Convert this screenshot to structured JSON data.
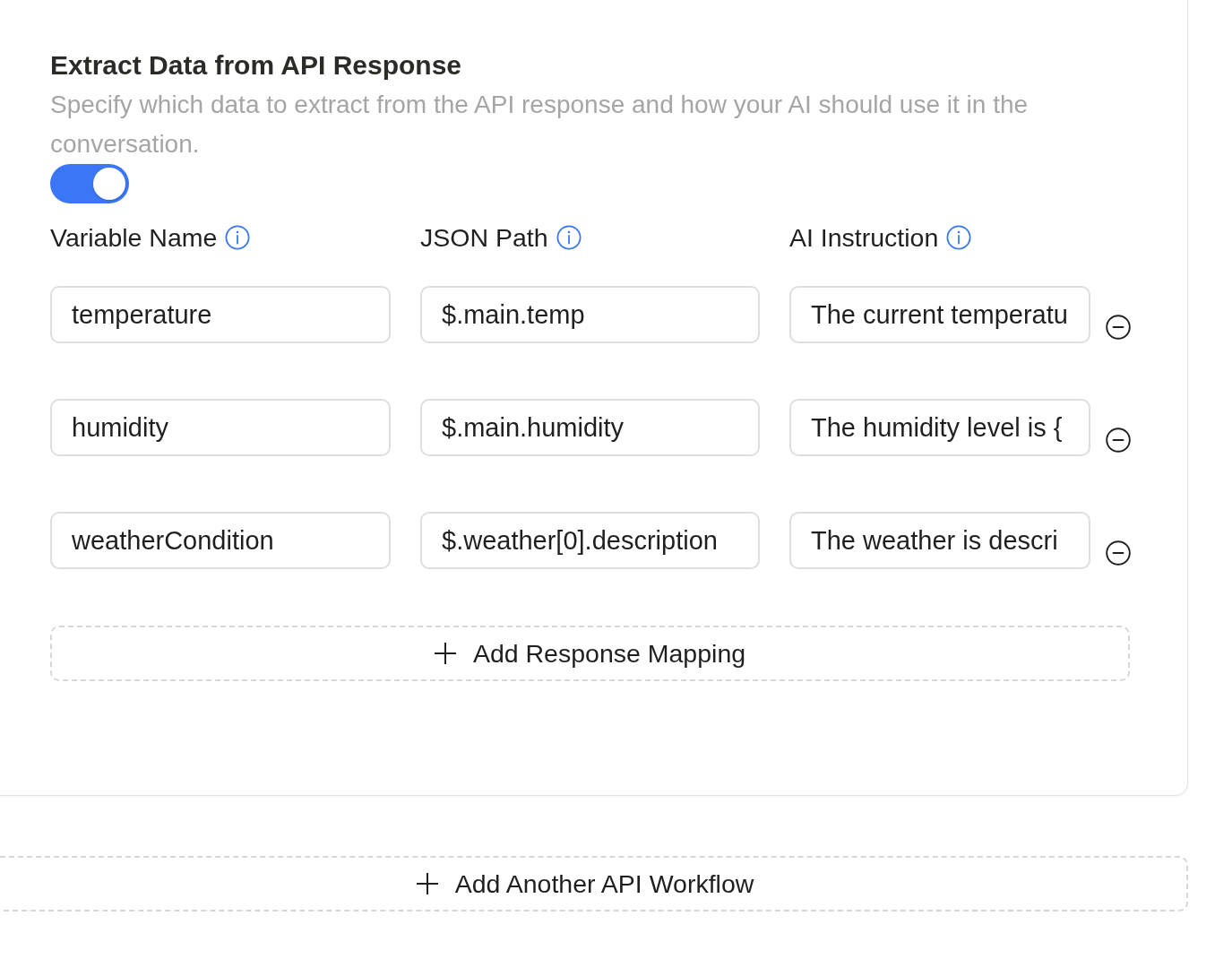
{
  "section": {
    "title": "Extract Data from API Response",
    "description": "Specify which data to extract from the API response and how your AI should use it in the conversation.",
    "enabled": true
  },
  "columns": [
    {
      "label": "Variable Name"
    },
    {
      "label": "JSON Path"
    },
    {
      "label": "AI Instruction"
    }
  ],
  "mappings": [
    {
      "variable_name": "temperature",
      "json_path": "$.main.temp",
      "ai_instruction": "The current temperatu"
    },
    {
      "variable_name": "humidity",
      "json_path": "$.main.humidity",
      "ai_instruction": "The humidity level is {"
    },
    {
      "variable_name": "weatherCondition",
      "json_path": "$.weather[0].description",
      "ai_instruction": "The weather is descri"
    }
  ],
  "add_mapping_button": "Add Response Mapping",
  "add_workflow_button": "Add Another API Workflow"
}
